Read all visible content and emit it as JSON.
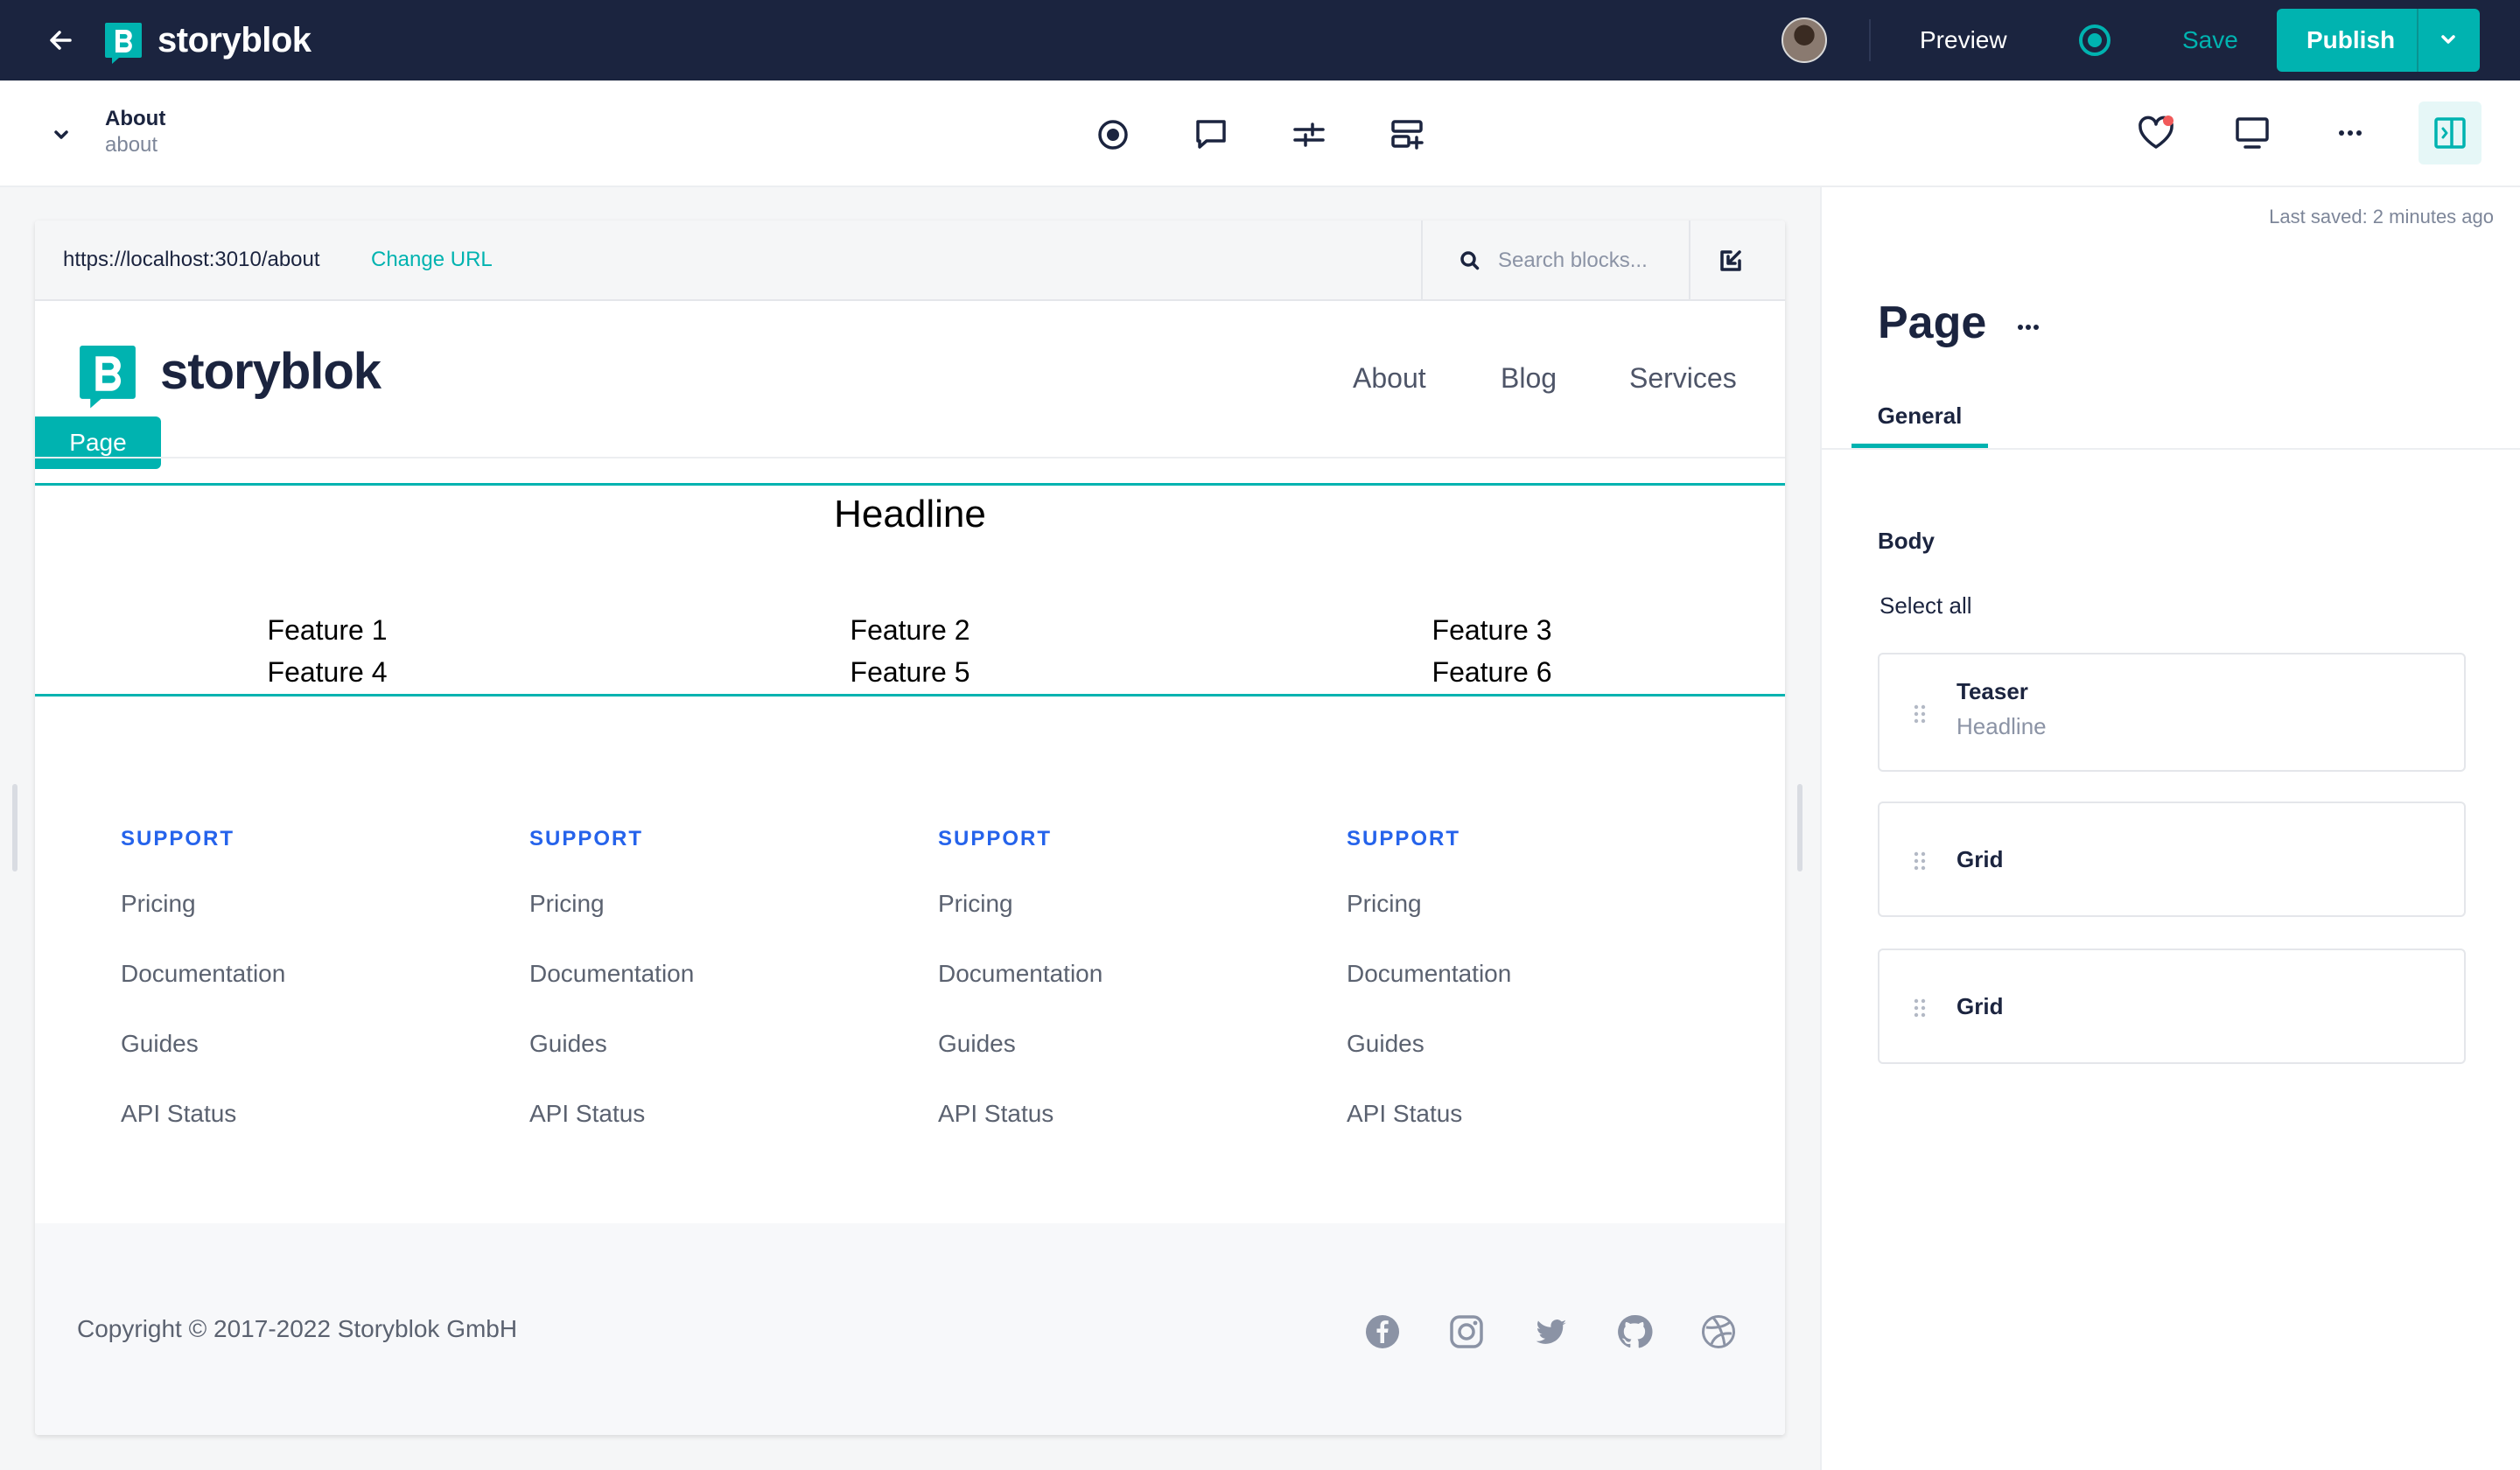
{
  "topbar": {
    "brand": "storyblok",
    "preview_label": "Preview",
    "save_label": "Save",
    "publish_label": "Publish"
  },
  "story": {
    "name": "About",
    "slug": "about"
  },
  "urlbar": {
    "url": "https://localhost:3010/about",
    "change_url_label": "Change URL",
    "search_placeholder": "Search blocks..."
  },
  "site": {
    "logo_text": "storyblok",
    "nav": [
      "About",
      "Blog",
      "Services"
    ],
    "page_badge": "Page",
    "headline": "Headline",
    "features": [
      "Feature 1",
      "Feature 2",
      "Feature 3",
      "Feature 4",
      "Feature 5",
      "Feature 6"
    ],
    "footer_columns": [
      {
        "title": "SUPPORT",
        "links": [
          "Pricing",
          "Documentation",
          "Guides",
          "API Status"
        ]
      },
      {
        "title": "SUPPORT",
        "links": [
          "Pricing",
          "Documentation",
          "Guides",
          "API Status"
        ]
      },
      {
        "title": "SUPPORT",
        "links": [
          "Pricing",
          "Documentation",
          "Guides",
          "API Status"
        ]
      },
      {
        "title": "SUPPORT",
        "links": [
          "Pricing",
          "Documentation",
          "Guides",
          "API Status"
        ]
      }
    ],
    "copyright": "Copyright © 2017-2022  Storyblok GmbH",
    "social_icons": [
      "facebook-icon",
      "instagram-icon",
      "twitter-icon",
      "github-icon",
      "dribbble-icon"
    ]
  },
  "panel": {
    "last_saved": "Last saved: 2 minutes ago",
    "title": "Page",
    "tab": "General",
    "body_label": "Body",
    "select_all": "Select all",
    "blocks": [
      {
        "title": "Teaser",
        "subtitle": "Headline"
      },
      {
        "title": "Grid"
      },
      {
        "title": "Grid"
      }
    ]
  },
  "colors": {
    "topbar_bg": "#1b243f",
    "accent": "#00b3b0",
    "footer_heading": "#2563eb",
    "notification_dot": "#f15a5a"
  }
}
